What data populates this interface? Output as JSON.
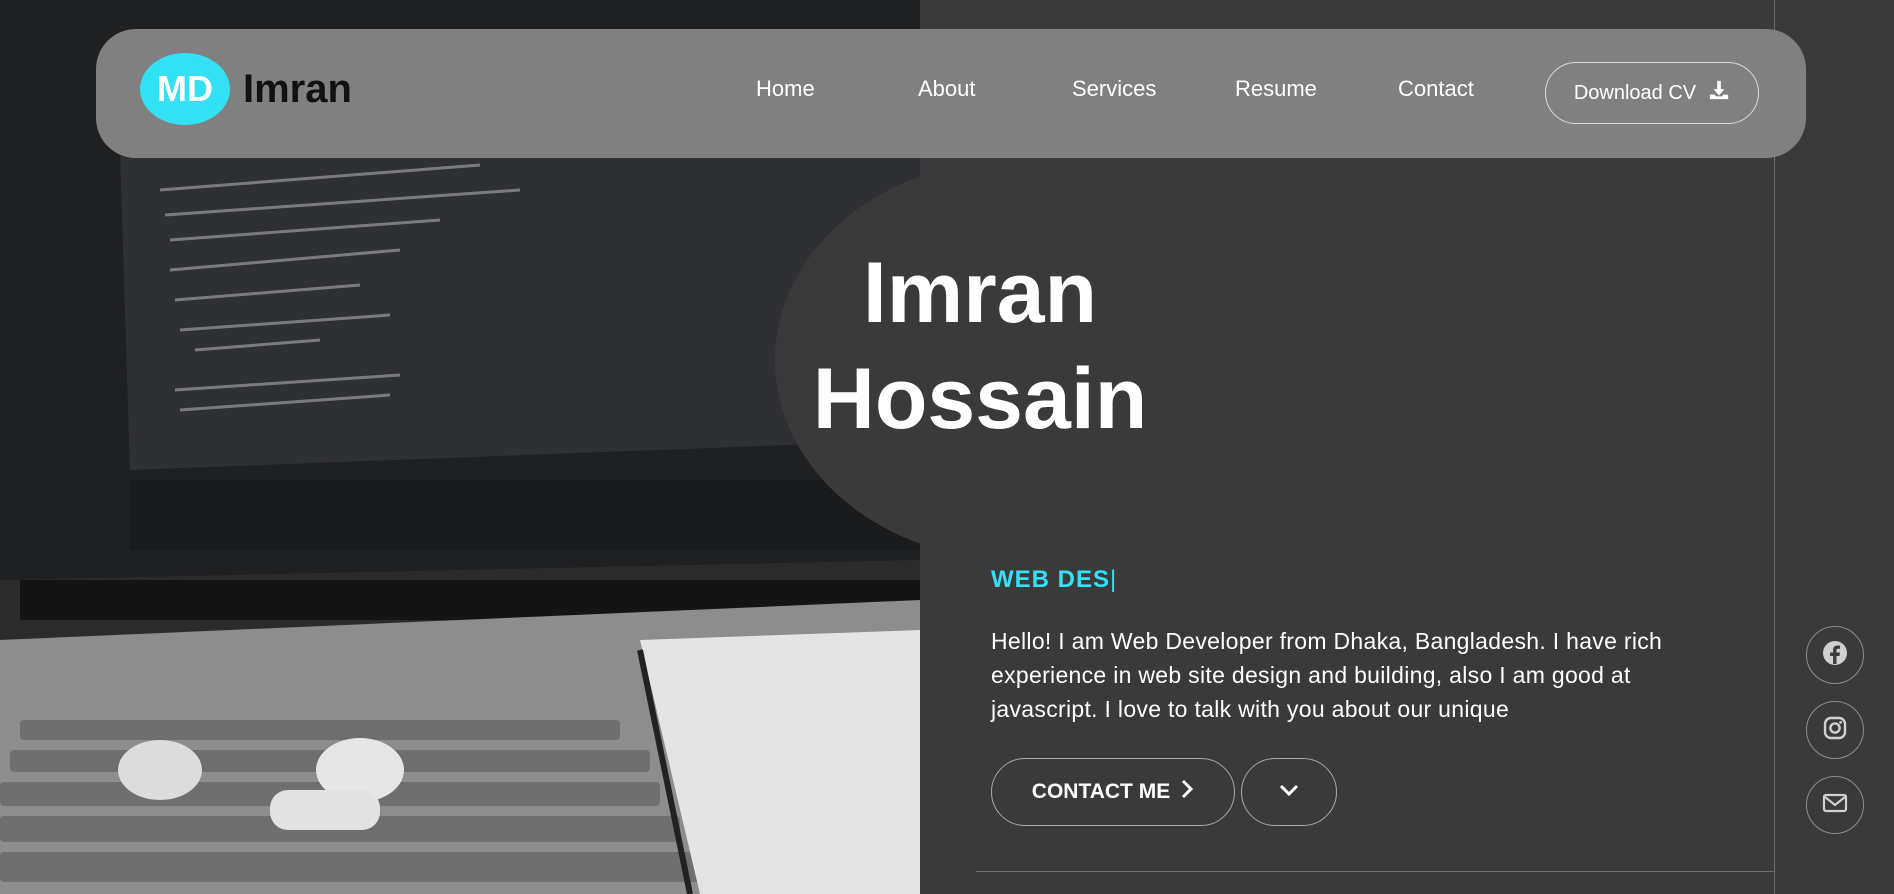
{
  "brand": {
    "badge": "MD",
    "name": "Imran"
  },
  "nav": {
    "links": [
      "Home",
      "About",
      "Services",
      "Resume",
      "Contact"
    ],
    "cv_label": "Download CV"
  },
  "hero": {
    "title_line1": "Imran",
    "title_line2": "Hossain",
    "typed_text": "WEB DES",
    "caret": "|",
    "intro": "Hello! I am Web Developer from Dhaka, Bangladesh. I have rich experience in web site design and building, also I am good at javascript. I love to talk with you about our unique",
    "contact_label": "CONTACT ME"
  },
  "social": [
    "facebook-icon",
    "instagram-icon",
    "mail-icon"
  ],
  "colors": {
    "accent": "#33e1f5",
    "background": "#3b3a3b",
    "navbar": "#808080"
  }
}
